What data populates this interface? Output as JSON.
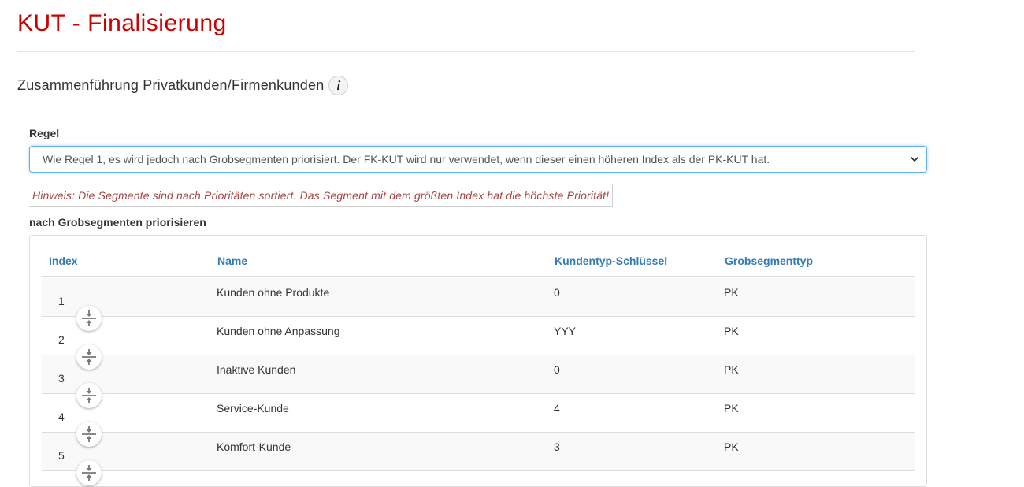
{
  "header": {
    "title": "KUT - Finalisierung",
    "subtitle": "Zusammenführung Privatkunden/Firmenkunden",
    "info_icon": "i"
  },
  "rule": {
    "label": "Regel",
    "selected": "Wie Regel 1, es wird jedoch nach Grobsegmenten priorisiert. Der FK-KUT wird nur verwendet, wenn dieser einen höheren Index als der PK-KUT hat."
  },
  "hint": "Hinweis: Die Segmente sind nach Prioritäten sortiert. Das Segment mit dem größten Index hat die höchste Priorität!",
  "section_label": "nach Grobsegmenten priorisieren",
  "table": {
    "columns": [
      "Index",
      "Name",
      "Kundentyp-Schlüssel",
      "Grobsegmenttyp"
    ],
    "rows": [
      {
        "index": "1",
        "name": "Kunden ohne Produkte",
        "key": "0",
        "type": "PK"
      },
      {
        "index": "2",
        "name": "Kunden ohne Anpassung",
        "key": "YYY",
        "type": "PK"
      },
      {
        "index": "3",
        "name": "Inaktive Kunden",
        "key": "0",
        "type": "PK"
      },
      {
        "index": "4",
        "name": "Service-Kunde",
        "key": "4",
        "type": "PK"
      },
      {
        "index": "5",
        "name": "Komfort-Kunde",
        "key": "3",
        "type": "PK"
      }
    ]
  },
  "colors": {
    "title": "#cc0000",
    "header_link": "#337ab7",
    "hint": "#a94442",
    "focus_border": "#66afe9"
  },
  "icons": {
    "info": "info-icon",
    "swap": "swap-vertical-icon",
    "select": "chevron-down-icon"
  }
}
